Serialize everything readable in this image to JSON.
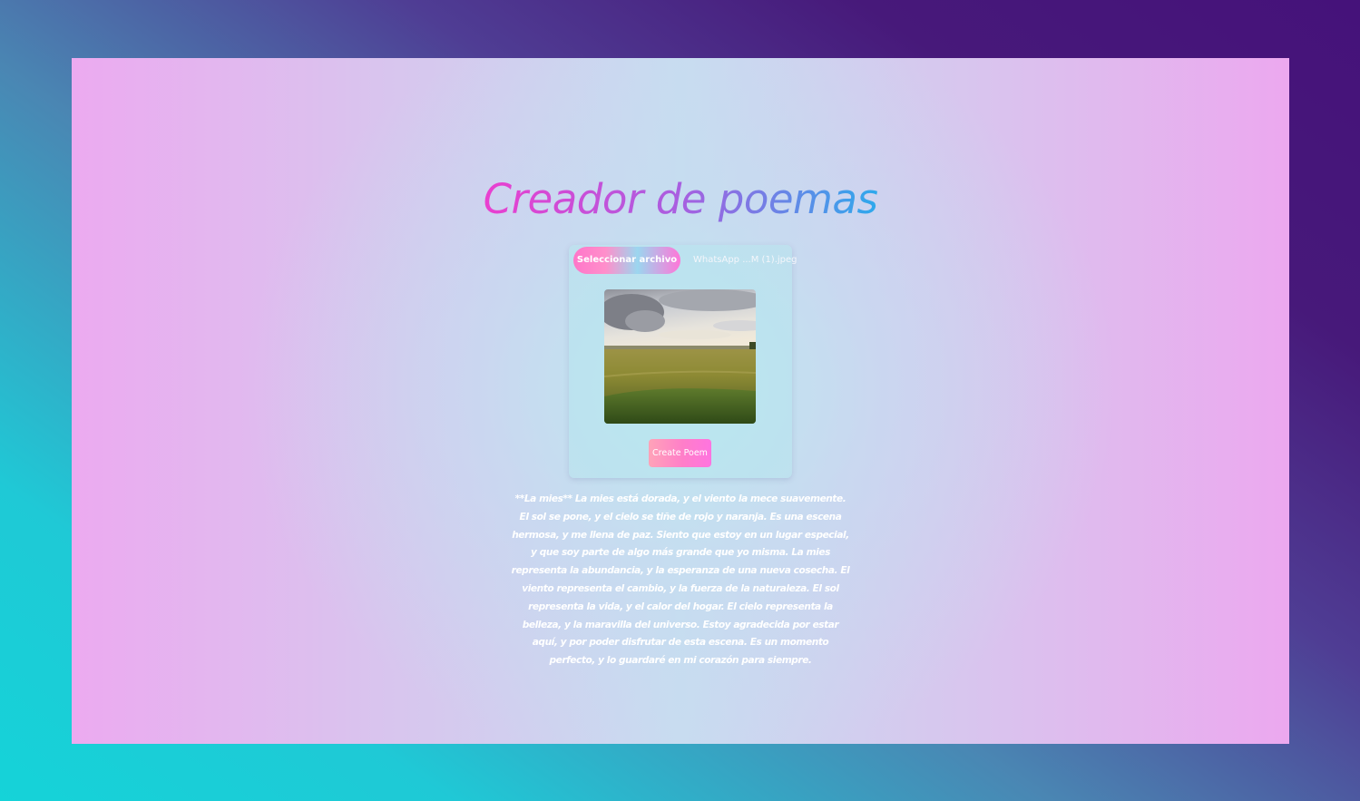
{
  "app": {
    "title": "Creador de poemas"
  },
  "upload": {
    "select_button_label": "Seleccionar archivo",
    "file_name": "WhatsApp ...M (1).jpeg"
  },
  "actions": {
    "create_button_label": "Create Poem"
  },
  "poem": {
    "text": "**La mies** La mies está dorada, y el viento la mece suavemente. El sol se pone, y el cielo se tiñe de rojo y naranja. Es una escena hermosa, y me llena de paz. Siento que estoy en un lugar especial, y que soy parte de algo más grande que yo misma. La mies representa la abundancia, y la esperanza de una nueva cosecha. El viento representa el cambio, y la fuerza de la naturaleza. El sol representa la vida, y el calor del hogar. El cielo representa la belleza, y la maravilla del universo. Estoy agradecida por estar aquí, y por poder disfrutar de esta escena. Es un momento perfecto, y lo guardaré en mi corazón para siempre."
  },
  "colors": {
    "title_gradient_start": "#ea3fcf",
    "title_gradient_end": "#2ea9ec",
    "button_pink": "#ff76c9",
    "poem_text": "#ffffff"
  }
}
